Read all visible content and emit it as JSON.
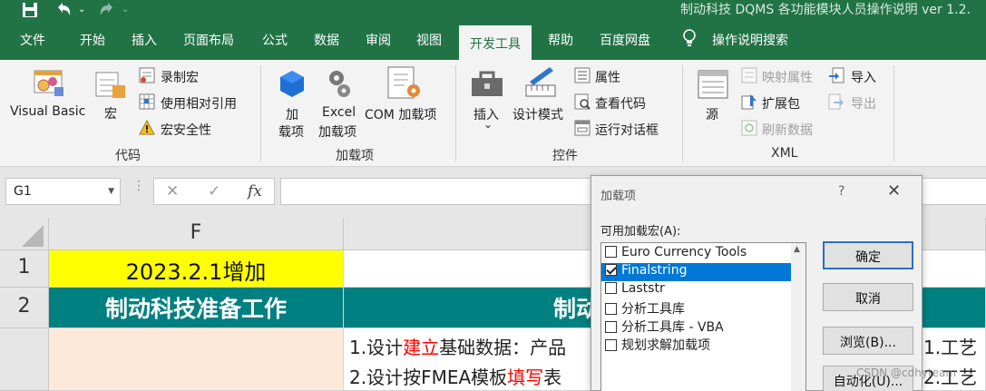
{
  "titlebar": {
    "title": "制动科技 DQMS 各功能模块人员操作说明 ver 1.2."
  },
  "tabs": [
    "文件",
    "开始",
    "插入",
    "页面布局",
    "公式",
    "数据",
    "审阅",
    "视图",
    "开发工具",
    "帮助",
    "百度网盘",
    "操作说明搜索"
  ],
  "active_tab": "开发工具",
  "ribbon": {
    "code": {
      "visual_basic": "Visual Basic",
      "macros": "宏",
      "record_macro": "录制宏",
      "relative_refs": "使用相对引用",
      "macro_security": "宏安全性",
      "title": "代码"
    },
    "addins": {
      "addins_1": "加",
      "addins_2": "载项",
      "excel_addins_1": "Excel",
      "excel_addins_2": "加载项",
      "com_addins": "COM 加载项",
      "title": "加载项"
    },
    "controls": {
      "insert": "插入",
      "insert_arrow": "⌄",
      "design_mode": "设计模式",
      "properties": "属性",
      "view_code": "查看代码",
      "run_dialog": "运行对话框",
      "title": "控件"
    },
    "xml": {
      "source": "源",
      "map_properties": "映射属性",
      "expansion_packs": "扩展包",
      "refresh_data": "刷新数据",
      "import": "导入",
      "export": "导出",
      "title": "XML"
    }
  },
  "formula_bar": {
    "name_box": "G1",
    "cancel": "✕",
    "enter": "✓",
    "fx": "fx"
  },
  "sheet": {
    "column_f": "F",
    "row1": "1",
    "row2": "2",
    "f1": "2023.2.1增加",
    "f2": "制动科技准备工作",
    "g2": "制动",
    "g3_line1_a": "1.设计",
    "g3_line1_b": "建立",
    "g3_line1_c": "基础数据：产品",
    "g3_line2_a": "2.设计按FMEA模板",
    "g3_line2_b": "填写",
    "g3_line2_c": "表",
    "h3_line1": "1.工艺",
    "h3_line2": "2.工艺"
  },
  "dialog": {
    "title": "加载项",
    "help": "?",
    "close": "✕",
    "list_label": "可用加载宏(A):",
    "items": [
      {
        "label": "Euro Currency Tools",
        "checked": false
      },
      {
        "label": "Finalstring",
        "checked": true
      },
      {
        "label": "Laststr",
        "checked": false
      },
      {
        "label": "分析工具库",
        "checked": false
      },
      {
        "label": "分析工具库 - VBA",
        "checked": false
      },
      {
        "label": "规划求解加载项",
        "checked": false
      }
    ],
    "ok": "确定",
    "cancel": "取消",
    "browse": "浏览(B)...",
    "automation": "自动化(U)..."
  },
  "watermark": "CSDN @cdhyteam",
  "colors": {
    "excel_green": "#217346",
    "header_yellow": "#ffff00",
    "teal_header": "#008080",
    "cell_peach": "#fde9d9",
    "accent_red": "#ff0000",
    "selection_blue": "#0078d7"
  }
}
